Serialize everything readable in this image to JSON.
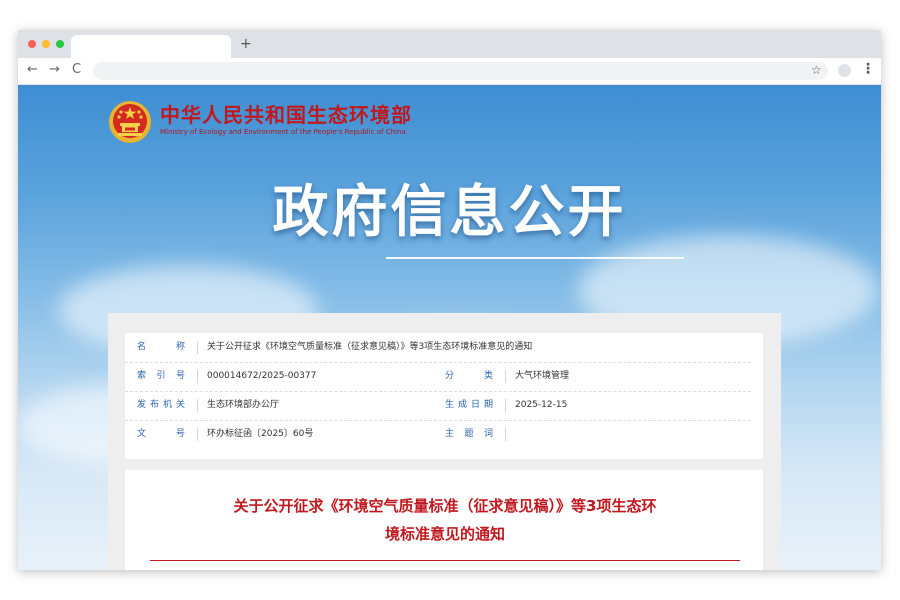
{
  "browser": {
    "new_tab_symbol": "+",
    "back_symbol": "←",
    "forward_symbol": "→",
    "reload_symbol": "C",
    "star_symbol": "☆",
    "menu_symbol": "⋮"
  },
  "site": {
    "title": "中华人民共和国生态环境部",
    "subtitle": "Ministry of Ecology and Environment of the People's Republic of China"
  },
  "hero": {
    "title": "政府信息公开"
  },
  "info_table": {
    "rows": [
      {
        "label": "名称",
        "value": "关于公开征求《环境空气质量标准（征求意见稿）》等3项生态环境标准意见的通知"
      },
      {
        "label": "索引号",
        "value": "000014672/2025-00377",
        "label2": "分类",
        "value2": "大气环境管理"
      },
      {
        "label": "发布机关",
        "value": "生态环境部办公厅",
        "label2": "生成日期",
        "value2": "2025-12-15"
      },
      {
        "label": "文号",
        "value": "环办标征函〔2025〕60号",
        "label2": "主题词",
        "value2": ""
      }
    ]
  },
  "document": {
    "title_line1": "关于公开征求《环境空气质量标准（征求意见稿）》等3项生态环",
    "title_line2": "境标准意见的通知"
  },
  "colors": {
    "brand_red": "#c0181f",
    "label_blue": "#2a63b3",
    "sky_top": "#3f8ed2",
    "sky_bottom": "#e8f1f9"
  }
}
